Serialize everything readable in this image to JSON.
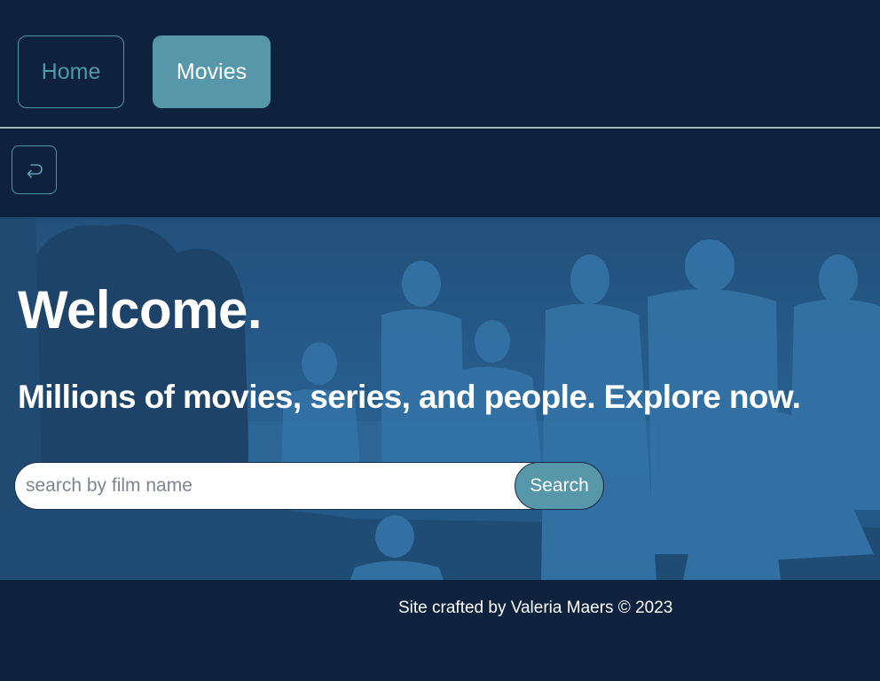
{
  "nav": {
    "home_label": "Home",
    "movies_label": "Movies",
    "active": "Movies"
  },
  "back_button": {
    "icon": "return-arrow-icon"
  },
  "hero": {
    "title": "Welcome.",
    "subtitle": "Millions of movies, series, and people. Explore now.",
    "background_image": "movie-cast-poster"
  },
  "search": {
    "placeholder": "search by film name",
    "value": "",
    "button_label": "Search"
  },
  "footer": {
    "text": "Site crafted by Valeria Maers © 2023"
  },
  "colors": {
    "background": "#0e223d",
    "accent": "#5698aa",
    "accent_outline": "#4f95a8",
    "divider": "#a7b4c6",
    "hero_tint": "#2a6596"
  }
}
